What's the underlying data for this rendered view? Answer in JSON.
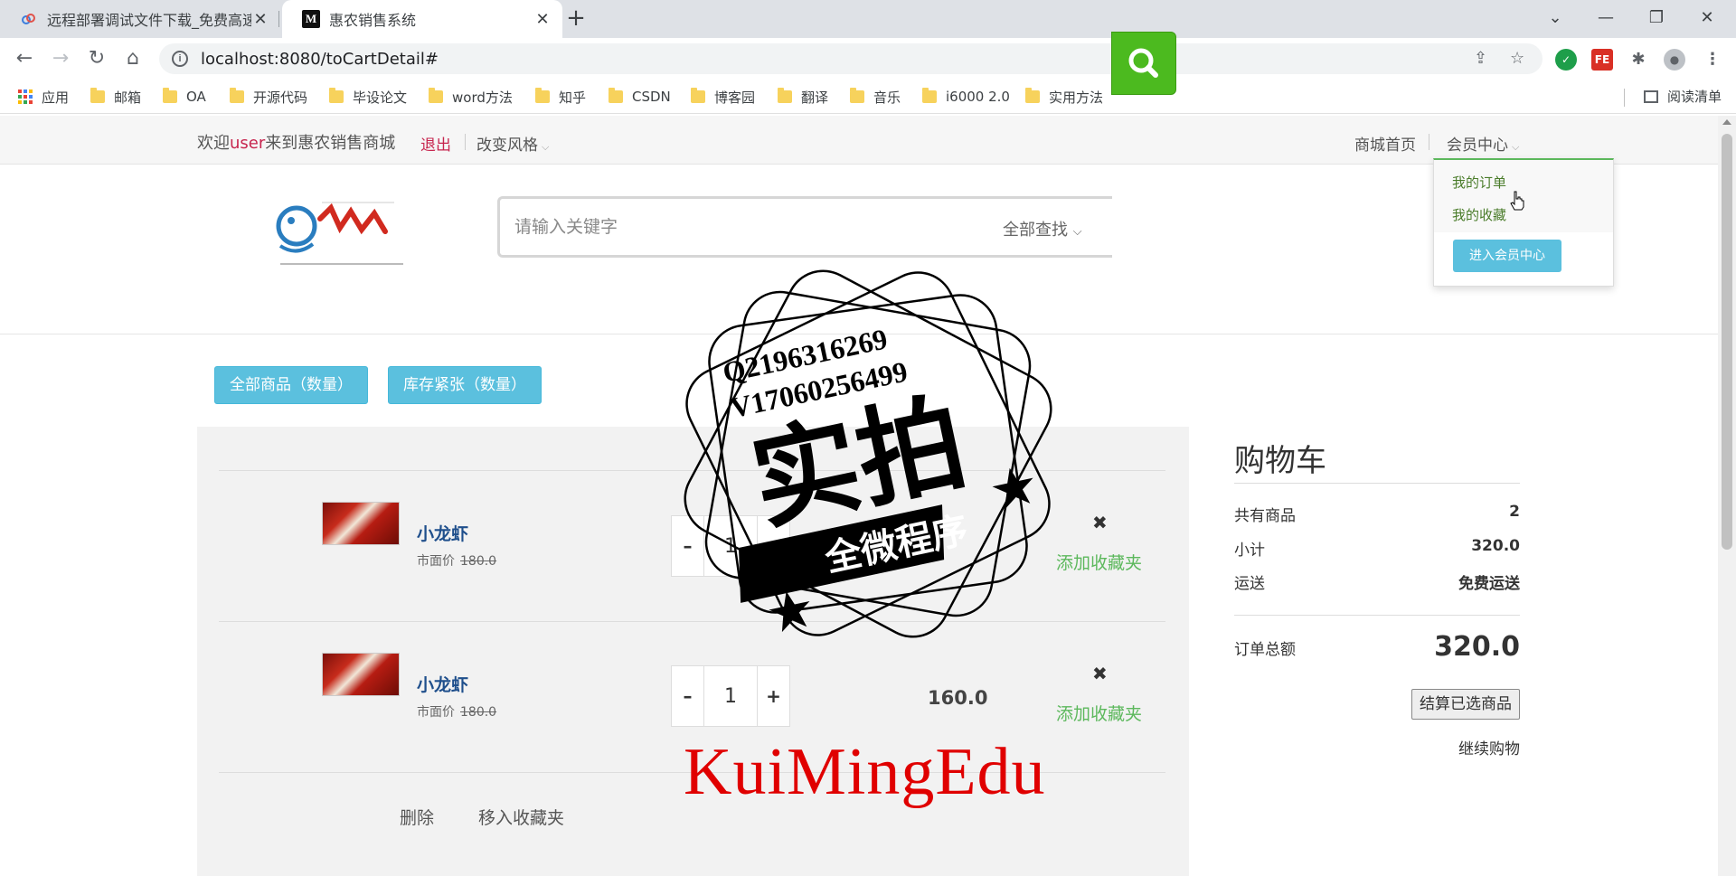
{
  "browser": {
    "tabs": [
      {
        "title": "远程部署调试文件下载_免费高速",
        "active": false
      },
      {
        "title": "惠农销售系统",
        "active": true
      }
    ],
    "url": "localhost:8080/toCartDetail#",
    "bookmarks": [
      "应用",
      "邮箱",
      "OA",
      "开源代码",
      "毕设论文",
      "word方法",
      "知乎",
      "CSDN",
      "博客园",
      "翻译",
      "音乐",
      "i6000 2.0",
      "实用方法"
    ],
    "reading_list": "阅读清单"
  },
  "topbar": {
    "welcome_prefix": "欢迎",
    "username": "user",
    "welcome_suffix": "来到惠农销售商城",
    "logout": "退出",
    "change_style": "改变风格",
    "home": "商城首页",
    "member_center": "会员中心"
  },
  "member_dropdown": {
    "my_orders": "我的订单",
    "my_favorites": "我的收藏",
    "enter_button": "进入会员中心"
  },
  "search": {
    "placeholder": "请输入关键字",
    "scope": "全部查找"
  },
  "filters": {
    "all_goods": "全部商品（数量）",
    "low_stock": "库存紧张（数量）"
  },
  "cart_items": [
    {
      "name": "小龙虾",
      "market_label": "市面价",
      "market_price": "180.0",
      "quantity": "1",
      "price": "",
      "add_fav": "添加收藏夹"
    },
    {
      "name": "小龙虾",
      "market_label": "市面价",
      "market_price": "180.0",
      "quantity": "1",
      "price": "160.0",
      "add_fav": "添加收藏夹"
    }
  ],
  "cart_actions": {
    "delete": "删除",
    "move_to_fav": "移入收藏夹"
  },
  "summary": {
    "title": "购物车",
    "item_count_label": "共有商品",
    "item_count": "2",
    "subtotal_label": "小计",
    "subtotal": "320.0",
    "shipping_label": "运送",
    "shipping": "免费运送",
    "total_label": "订单总额",
    "total": "320.0",
    "checkout": "结算已选商品",
    "continue": "继续购物"
  },
  "watermark": {
    "line1": "Q2196316269",
    "line2": "V17060256499",
    "big": "实拍",
    "banner": "全微程序",
    "brand": "KuiMingEdu"
  },
  "colors": {
    "accent_green": "#4cba1f",
    "cyan_button": "#5bc0de",
    "link_red": "#c7254e",
    "fav_green": "#5cb85c"
  }
}
